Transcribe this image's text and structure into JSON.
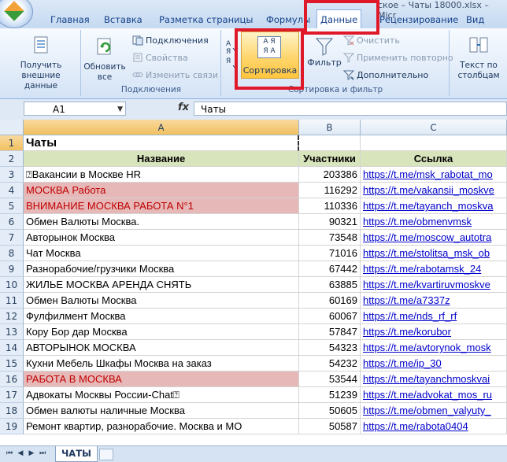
{
  "title_partial": "ское – Чаты 18000.xlsx – Micr",
  "tabs": [
    {
      "label": "Главная"
    },
    {
      "label": "Вставка"
    },
    {
      "label": "Разметка страницы"
    },
    {
      "label": "Формулы"
    },
    {
      "label": "Данные"
    },
    {
      "label": "Рецензирование"
    },
    {
      "label": "Вид"
    }
  ],
  "ribbon": {
    "external": {
      "label": "Получить внешние данные"
    },
    "connections": {
      "refresh": "Обновить все",
      "connections": "Подключения",
      "properties": "Свойства",
      "edit_links": "Изменить связи",
      "group": "Подключения"
    },
    "sortfilter": {
      "sort": "Сортировка",
      "filter": "Фильтр",
      "clear": "Очистить",
      "reapply": "Применить повторно",
      "advanced": "Дополнительно",
      "group": "Сортировка и фильтр",
      "az": "А Я",
      "ya": "Я А"
    },
    "text_to_columns": "Текст по столбцам"
  },
  "formula_bar": {
    "cell_ref": "A1",
    "fx": "fx",
    "value": "Чаты"
  },
  "columns": [
    "A",
    "B",
    "C"
  ],
  "sheet": {
    "title": "Чаты",
    "headers": [
      "Название",
      "Участники",
      "Ссылка"
    ],
    "rows": [
      {
        "n": "3",
        "name": "⍰Вакансии в Москве HR",
        "count": "203386",
        "link": "https://t.me/msk_rabotat_mo",
        "pink": false
      },
      {
        "n": "4",
        "name": "МОСКВА Работа",
        "count": "116292",
        "link": "https://t.me/vakansii_moskve",
        "pink": true
      },
      {
        "n": "5",
        "name": "ВНИМАНИЕ МОСКВА РАБОТА N°1",
        "count": "110336",
        "link": "https://t.me/tayanch_moskva",
        "pink": true
      },
      {
        "n": "6",
        "name": "Обмен Валюты Москва.",
        "count": "90321",
        "link": "https://t.me/obmenvmsk",
        "pink": false
      },
      {
        "n": "7",
        "name": "Авторынок Москва",
        "count": "73548",
        "link": "https://t.me/moscow_autotra",
        "pink": false
      },
      {
        "n": "8",
        "name": "Чат Москва",
        "count": "71016",
        "link": "https://t.me/stolitsa_msk_ob",
        "pink": false
      },
      {
        "n": "9",
        "name": "Разнорабочие/грузчики Москва",
        "count": "67442",
        "link": "https://t.me/rabotamsk_24",
        "pink": false
      },
      {
        "n": "10",
        "name": "ЖИЛЬЕ МОСКВА АРЕНДА СНЯТЬ",
        "count": "63885",
        "link": "https://t.me/kvartiruvmoskve",
        "pink": false
      },
      {
        "n": "11",
        "name": "Обмен Валюты Москва",
        "count": "60169",
        "link": "https://t.me/a7337z",
        "pink": false
      },
      {
        "n": "12",
        "name": "Фулфилмент Москва",
        "count": "60067",
        "link": "https://t.me/nds_rf_rf",
        "pink": false
      },
      {
        "n": "13",
        "name": "Кору Бор дар Москва",
        "count": "57847",
        "link": "https://t.me/korubor",
        "pink": false
      },
      {
        "n": "14",
        "name": "АВТОРЫНОК МОСКВА",
        "count": "54323",
        "link": "https://t.me/avtorynok_mosk",
        "pink": false
      },
      {
        "n": "15",
        "name": "Кухни Мебель Шкафы Москва на заказ",
        "count": "54232",
        "link": "https://t.me/ip_30",
        "pink": false
      },
      {
        "n": "16",
        "name": "РАБОТА В МОСКВА",
        "count": "53544",
        "link": "https://t.me/tayanchmoskvai",
        "pink": true
      },
      {
        "n": "17",
        "name": "Адвокаты Москвы России-Chat⍰",
        "count": "51239",
        "link": "https://t.me/advokat_mos_ru",
        "pink": false
      },
      {
        "n": "18",
        "name": "Обмен валюты наличные Москва",
        "count": "50605",
        "link": "https://t.me/obmen_valyuty_",
        "pink": false
      },
      {
        "n": "19",
        "name": "Ремонт квартир, разнорабочие. Москва и МО",
        "count": "50587",
        "link": "https://t.me/rabota0404",
        "pink": false
      }
    ]
  },
  "sheet_tab": "ЧАТЫ",
  "colors": {
    "accent_red": "#e0192a",
    "pink_fill": "#e6b8b7",
    "header_fill": "#d8e4bc",
    "link": "#0000cc"
  }
}
